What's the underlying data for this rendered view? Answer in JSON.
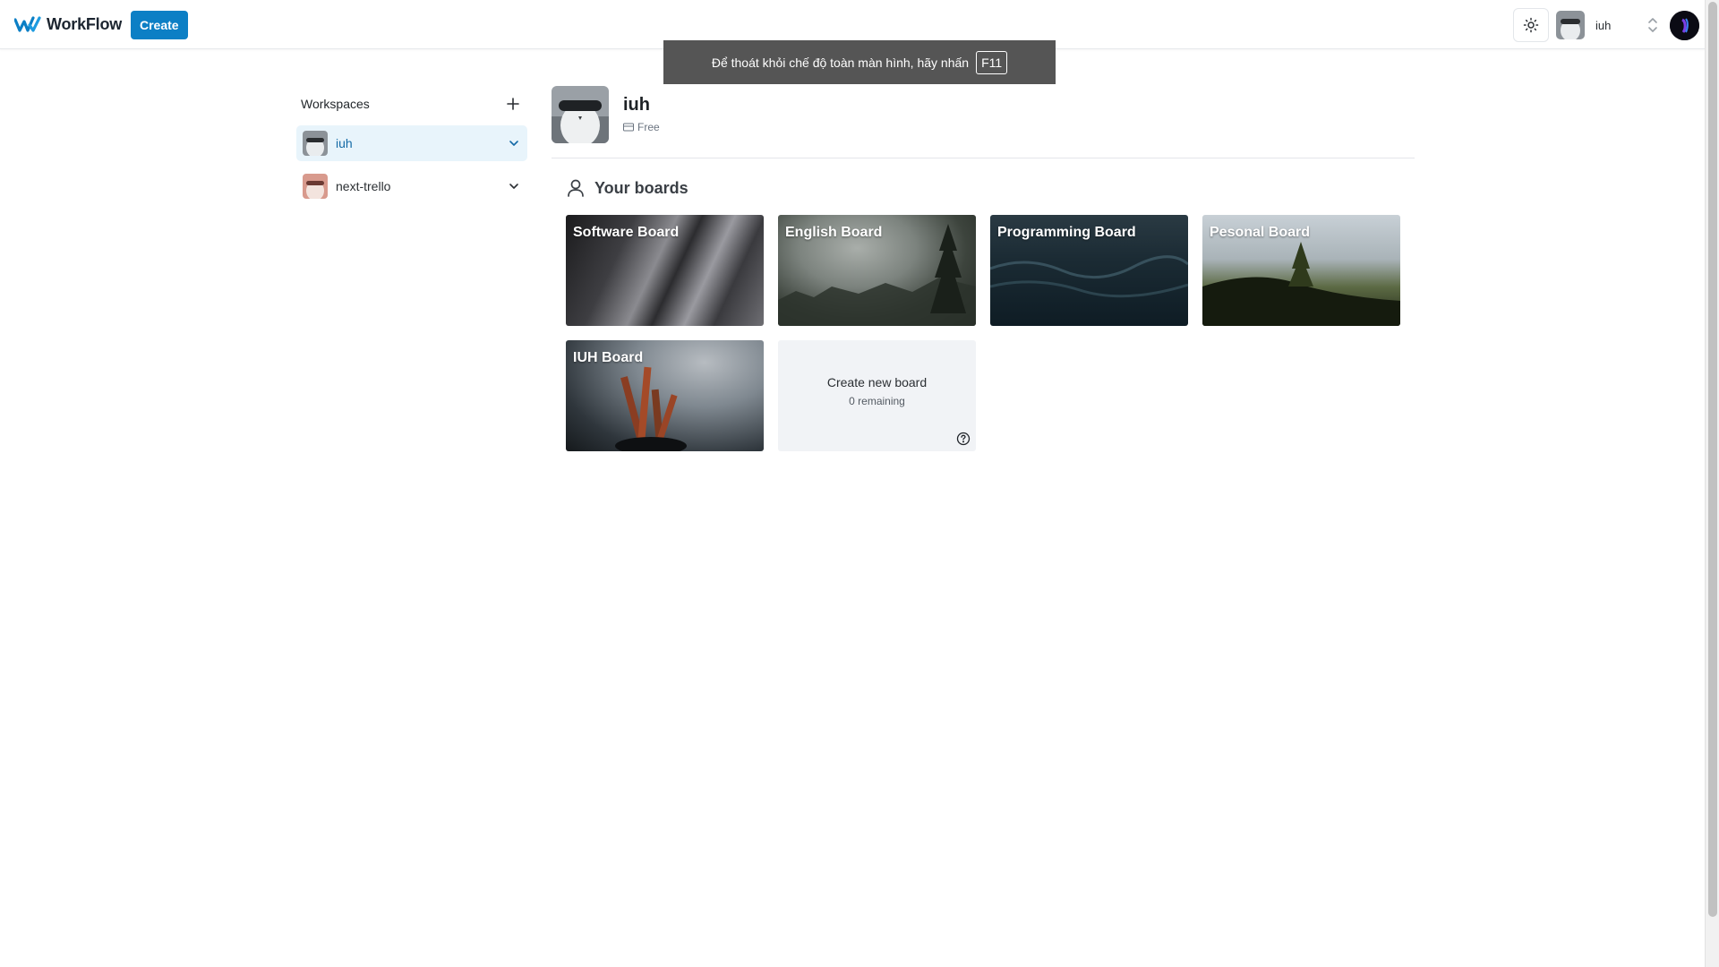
{
  "app": {
    "name": "WorkFlow",
    "brand_color": "#0c7fc5"
  },
  "navbar": {
    "create_label": "Create",
    "org_switcher": {
      "name": "iuh"
    }
  },
  "fullscreen_toast": {
    "message": "Để thoát khỏi chế độ toàn màn hình, hãy nhấn",
    "key": "F11"
  },
  "sidebar": {
    "title": "Workspaces",
    "items": [
      {
        "label": "iuh",
        "active": true
      },
      {
        "label": "next-trello",
        "active": false
      }
    ]
  },
  "org": {
    "name": "iuh",
    "plan": "Free"
  },
  "boards": {
    "heading": "Your boards",
    "items": [
      {
        "title": "Software Board"
      },
      {
        "title": "English Board"
      },
      {
        "title": "Programming Board"
      },
      {
        "title": "Pesonal Board"
      },
      {
        "title": "IUH Board"
      }
    ],
    "create": {
      "label": "Create new board",
      "remaining": "0 remaining"
    }
  }
}
